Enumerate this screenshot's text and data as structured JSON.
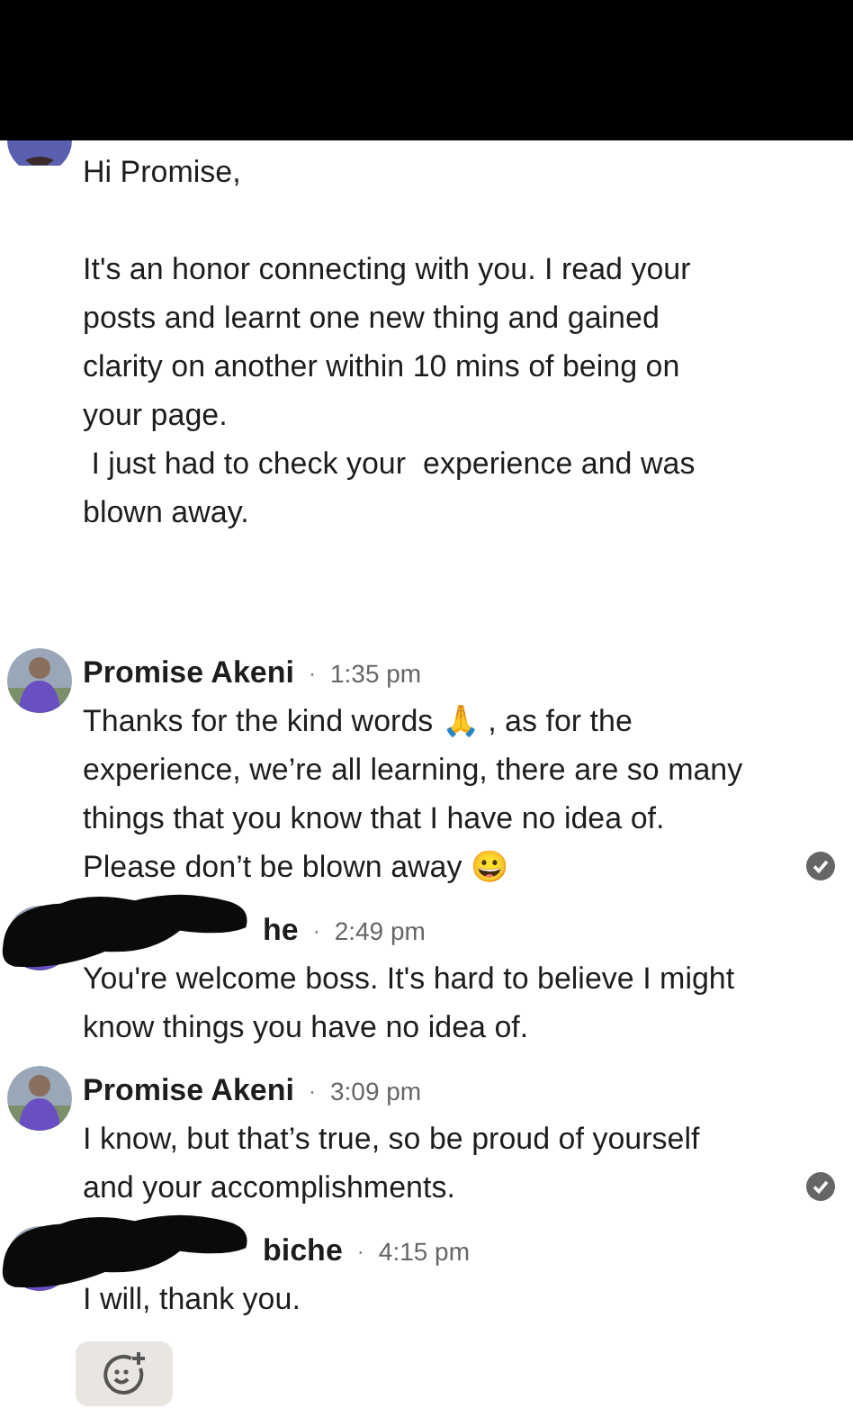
{
  "intro": {
    "greeting": "Hi Promise,",
    "lines": [
      "It's an honor connecting with you. I read your",
      "posts and learnt one new thing and gained",
      "clarity on another within 10 mins of being on",
      "your page.",
      " I just had to check your  experience and was",
      "blown away."
    ]
  },
  "messages": [
    {
      "kind": "named",
      "author": "Promise Akeni",
      "separator": "·",
      "time": "1:35 pm",
      "seen": true,
      "lines": [
        "Thanks for the kind words 🙏 , as for the",
        "experience, we’re all learning, there are so many",
        "things that you know that I have no idea of.",
        "Please don’t be blown away 😀"
      ]
    },
    {
      "kind": "redacted",
      "author": "he",
      "separator": "·",
      "time": "2:49 pm",
      "seen": false,
      "lines": [
        "You're welcome boss. It's hard to believe I might",
        "know things you have no idea of."
      ]
    },
    {
      "kind": "named",
      "author": "Promise Akeni",
      "separator": "·",
      "time": "3:09 pm",
      "seen": true,
      "lines": [
        "I know, but that’s true, so be proud of yourself",
        "and your accomplishments."
      ]
    },
    {
      "kind": "redacted",
      "author": "biche",
      "separator": "·",
      "time": "4:15 pm",
      "seen": false,
      "lines": [
        "I will, thank you."
      ]
    }
  ]
}
